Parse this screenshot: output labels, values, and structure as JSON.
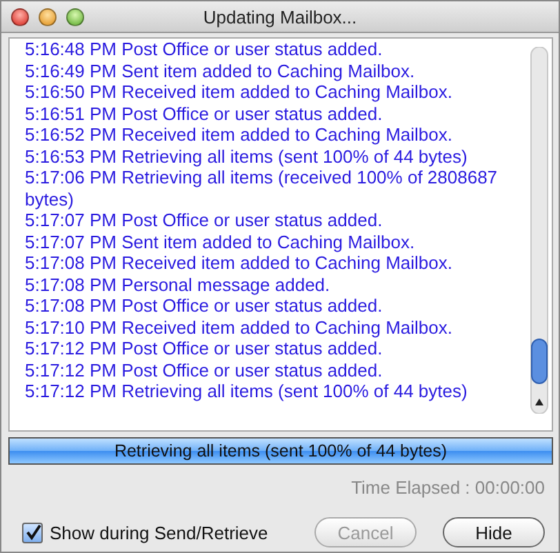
{
  "window": {
    "title": "Updating Mailbox..."
  },
  "log": [
    {
      "time": "5:16:48 PM",
      "message": "Post Office or user status added."
    },
    {
      "time": "5:16:49 PM",
      "message": "Sent item added to Caching Mailbox."
    },
    {
      "time": "5:16:50 PM",
      "message": "Received item added to Caching Mailbox."
    },
    {
      "time": "5:16:51 PM",
      "message": "Post Office or user status added."
    },
    {
      "time": "5:16:52 PM",
      "message": "Received item added to Caching Mailbox."
    },
    {
      "time": "5:16:53 PM",
      "message": "Retrieving all items (sent 100% of 44 bytes)"
    },
    {
      "time": "5:17:06 PM",
      "message": "Retrieving all items (received 100% of 2808687 bytes)"
    },
    {
      "time": "5:17:07 PM",
      "message": "Post Office or user status added."
    },
    {
      "time": "5:17:07 PM",
      "message": "Sent item added to Caching Mailbox."
    },
    {
      "time": "5:17:08 PM",
      "message": "Received item added to Caching Mailbox."
    },
    {
      "time": "5:17:08 PM",
      "message": "Personal message added."
    },
    {
      "time": "5:17:08 PM",
      "message": "Post Office or user status added."
    },
    {
      "time": "5:17:10 PM",
      "message": "Received item added to Caching Mailbox."
    },
    {
      "time": "5:17:12 PM",
      "message": "Post Office or user status added."
    },
    {
      "time": "5:17:12 PM",
      "message": "Post Office or user status added."
    },
    {
      "time": "5:17:12 PM",
      "message": "Retrieving all items (sent 100% of 44 bytes)"
    }
  ],
  "progress": {
    "label": "Retrieving all items (sent 100% of 44 bytes)",
    "level": 1
  },
  "time_elapsed": "Time Elapsed : 00:00:00",
  "show_during_send_retrieve": {
    "label": "Show during Send/Retrieve",
    "checked": true
  },
  "buttons": [
    {
      "label": "Cancel",
      "disabled": true
    },
    {
      "label": "Hide",
      "disabled": false
    }
  ]
}
